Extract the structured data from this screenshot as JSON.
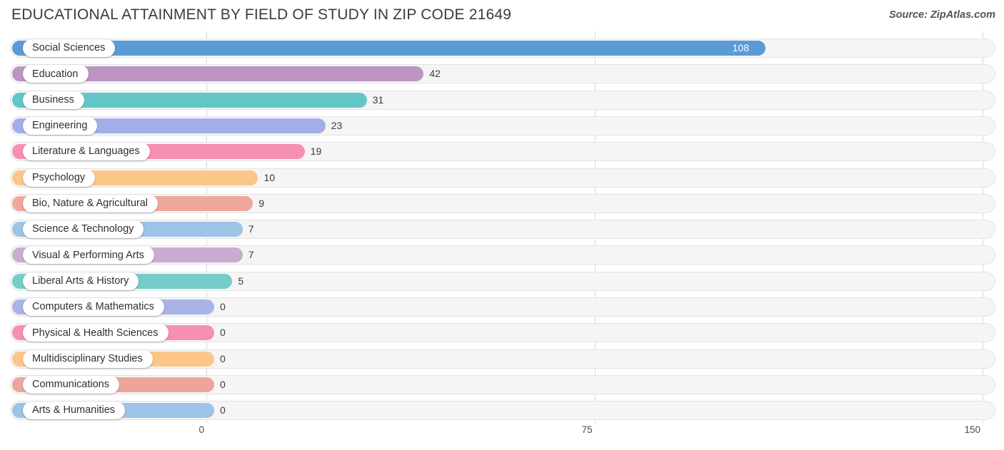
{
  "header": {
    "title": "EDUCATIONAL ATTAINMENT BY FIELD OF STUDY IN ZIP CODE 21649",
    "source": "Source: ZipAtlas.com"
  },
  "chart_data": {
    "type": "bar",
    "orientation": "horizontal",
    "title": "EDUCATIONAL ATTAINMENT BY FIELD OF STUDY IN ZIP CODE 21649",
    "subtitle": "",
    "xlabel": "",
    "ylabel": "",
    "xlim": [
      0,
      150
    ],
    "xticks": [
      0,
      75,
      150
    ],
    "xtick_labels": [
      "0",
      "75",
      "150"
    ],
    "grid": true,
    "legend": false,
    "categories": [
      "Social Sciences",
      "Education",
      "Business",
      "Engineering",
      "Literature & Languages",
      "Psychology",
      "Bio, Nature & Agricultural",
      "Science & Technology",
      "Visual & Performing Arts",
      "Liberal Arts & History",
      "Computers & Mathematics",
      "Physical & Health Sciences",
      "Multidisciplinary Studies",
      "Communications",
      "Arts & Humanities"
    ],
    "values": [
      108,
      42,
      31,
      23,
      19,
      10,
      9,
      7,
      7,
      5,
      0,
      0,
      0,
      0,
      0
    ],
    "value_labels": [
      "108",
      "42",
      "31",
      "23",
      "19",
      "10",
      "9",
      "7",
      "7",
      "5",
      "0",
      "0",
      "0",
      "0",
      "0"
    ],
    "colors": [
      "#5b9bd5",
      "#bd94c4",
      "#63c6c6",
      "#a3aee8",
      "#f78fb3",
      "#fbc687",
      "#f0a79b",
      "#9dc3e6",
      "#cbabd1",
      "#74cdc9",
      "#a9b3e8",
      "#f78fb3",
      "#fbc687",
      "#eda49b",
      "#9dc3e6"
    ]
  },
  "colors": {
    "track": "#f5f5f5",
    "track_border": "#e3e3e3",
    "gridline": "#d8d8d8",
    "title_text": "#3b3b3b",
    "label_text": "#2f2f2f",
    "value_text": "#3a3a3a"
  }
}
